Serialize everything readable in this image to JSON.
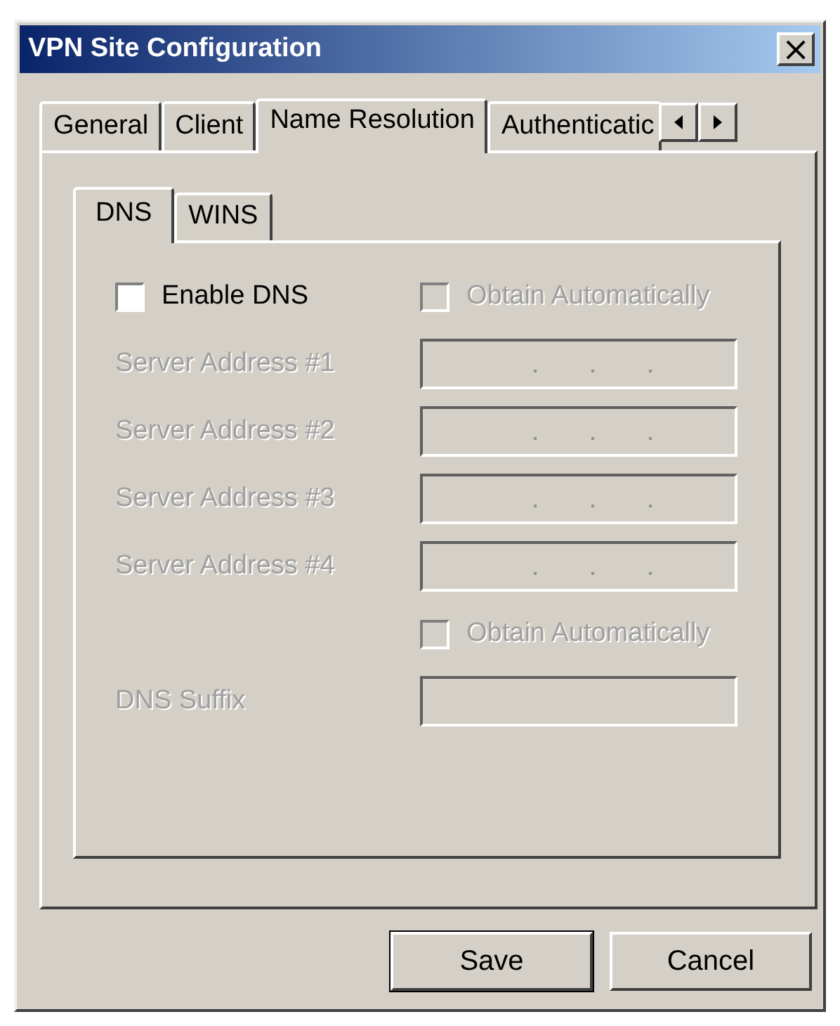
{
  "window": {
    "title": "VPN Site Configuration",
    "close": "×"
  },
  "tabs": [
    {
      "label": "General",
      "selected": false
    },
    {
      "label": "Client",
      "selected": false
    },
    {
      "label": "Name Resolution",
      "selected": true
    },
    {
      "label": "Authenticatic",
      "selected": false
    }
  ],
  "subtabs": [
    {
      "label": "DNS",
      "selected": true
    },
    {
      "label": "WINS",
      "selected": false
    }
  ],
  "rows": [
    {
      "kind": "checkboxes",
      "label": "Enable DNS",
      "checked": false,
      "disabled": false,
      "right": {
        "label": "Obtain Automatically",
        "checked": false,
        "disabled": true
      }
    },
    {
      "kind": "ip",
      "label": "Server Address #1",
      "disabled": true
    },
    {
      "kind": "ip",
      "label": "Server Address #2",
      "disabled": true
    },
    {
      "kind": "ip",
      "label": "Server Address #3",
      "disabled": true
    },
    {
      "kind": "ip",
      "label": "Server Address #4",
      "disabled": true
    },
    {
      "kind": "checkbox-right",
      "label": "Obtain Automatically",
      "checked": false,
      "disabled": true
    },
    {
      "kind": "text",
      "label": "DNS Suffix",
      "disabled": true
    }
  ],
  "buttons": [
    {
      "label": "Save",
      "default": true
    },
    {
      "label": "Cancel",
      "default": false
    }
  ]
}
